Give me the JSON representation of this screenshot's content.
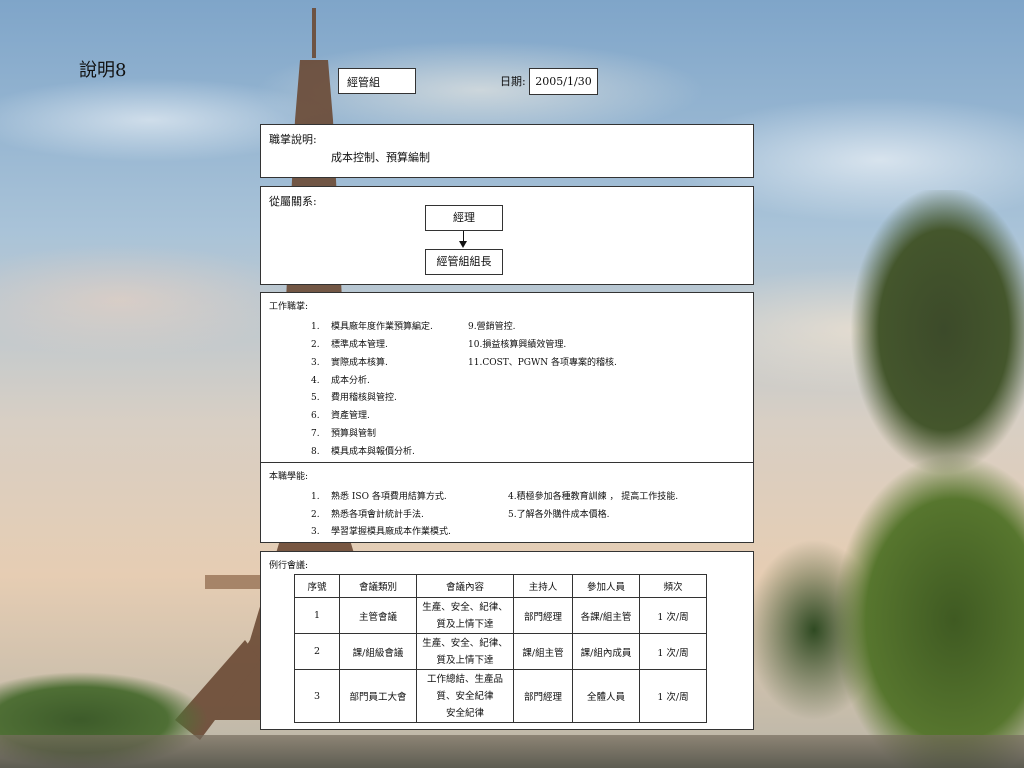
{
  "slide_title": "說明8",
  "unit": "經管組",
  "date_label": "日期:",
  "date_value": "2005/1/30",
  "responsibility": {
    "title": "職掌說明:",
    "text": "成本控制、預算編制"
  },
  "reporting": {
    "title": "從屬關系:",
    "manager": "經理",
    "lead": "經管組組長"
  },
  "duties": {
    "title": "工作職掌:",
    "left": [
      {
        "num": "1.",
        "text": "模具廠年度作業預算編定."
      },
      {
        "num": "2.",
        "text": "標準成本管理."
      },
      {
        "num": "3.",
        "text": "實際成本核算."
      },
      {
        "num": "4.",
        "text": "成本分析."
      },
      {
        "num": "5.",
        "text": "費用稽核與管控."
      },
      {
        "num": "6.",
        "text": "資產管理."
      },
      {
        "num": "7.",
        "text": "預算與管制"
      },
      {
        "num": "8.",
        "text": "模具成本與報價分析."
      }
    ],
    "right": [
      {
        "text": "9.營銷管控."
      },
      {
        "text": "10.損益核算興績效管理."
      },
      {
        "text": "11.COST、PGWN 各项專案的稽核."
      }
    ]
  },
  "learning": {
    "title": "本職學能:",
    "left": [
      {
        "num": "1.",
        "text": "熟悉 ISO 各項費用結算方式."
      },
      {
        "num": "2.",
        "text": "熟悉各項會計統計手法."
      },
      {
        "num": "3.",
        "text": "學習掌握模具廠成本作業模式."
      }
    ],
    "right": [
      {
        "text": "4.積極參加各種教育訓練 ， 提高工作技能."
      },
      {
        "text": "5.了解各外購件成本價格."
      }
    ]
  },
  "meetings": {
    "title": "例行會議:",
    "headers": [
      "序號",
      "會議類別",
      "會議內容",
      "主持人",
      "參加人員",
      "頻次"
    ],
    "rows": [
      {
        "no": "1",
        "type": "主管會議",
        "content": [
          "生產、安全、紀律、",
          "質及上情下達"
        ],
        "host": "部門經理",
        "attendees": "各課/組主管",
        "freq": "1 次/周"
      },
      {
        "no": "2",
        "type": "課/組級會議",
        "content": [
          "生產、安全、紀律、",
          "質及上情下達"
        ],
        "host": "課/組主管",
        "attendees": "課/組內成員",
        "freq": "1 次/周"
      },
      {
        "no": "3",
        "type": "部門員工大會",
        "content": [
          "工作總結、生產品",
          "質、安全紀律",
          "安全紀律"
        ],
        "host": "部門經理",
        "attendees": "全體人員",
        "freq": "1 次/周"
      }
    ]
  }
}
